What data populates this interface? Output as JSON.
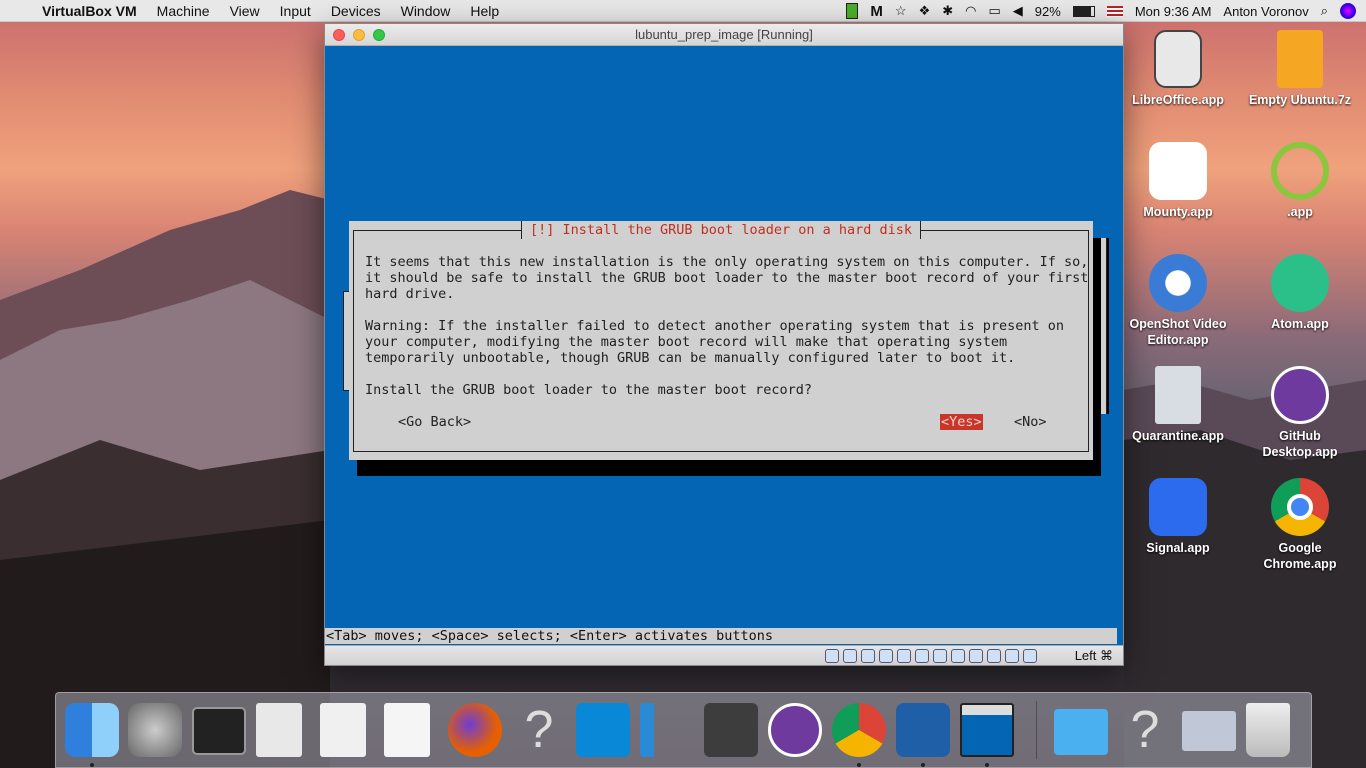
{
  "menubar": {
    "app_name": "VirtualBox VM",
    "menus": [
      "Machine",
      "View",
      "Input",
      "Devices",
      "Window",
      "Help"
    ],
    "battery": "92%",
    "clock": "Mon 9:36 AM",
    "user": "Anton Voronov",
    "status_icons": [
      "battery-icon",
      "malwarebytes-icon",
      "star-icon",
      "dropbox-icon",
      "bluetooth-icon",
      "wifi-icon",
      "airplay-icon",
      "volume-icon",
      "flag-us-icon",
      "search-icon",
      "siri-icon"
    ]
  },
  "vm": {
    "title": "lubuntu_prep_image [Running]",
    "dialog": {
      "title": "[!] Install the GRUB boot loader on a hard disk",
      "line1": "It seems that this new installation is the only operating system on this computer. If so,",
      "line2": "it should be safe to install the GRUB boot loader to the master boot record of your first",
      "line3": "hard drive.",
      "line4": "Warning: If the installer failed to detect another operating system that is present on",
      "line5": "your computer, modifying the master boot record will make that operating system",
      "line6": "temporarily unbootable, though GRUB can be manually configured later to boot it.",
      "question": "Install the GRUB boot loader to the master boot record?",
      "go_back": "<Go Back>",
      "yes": "<Yes>",
      "no": "<No>"
    },
    "help_line": "<Tab> moves; <Space> selects; <Enter> activates buttons",
    "host_key": "Left ⌘"
  },
  "desktop_icons": [
    {
      "label1": "LibreOffice.app",
      "label2": "",
      "color": "#e8e8e8"
    },
    {
      "label1": "Empty Ubuntu.7z",
      "label2": "",
      "color": "#f5a623"
    },
    {
      "label1": "Mounty.app",
      "label2": "",
      "color": "#ffffff"
    },
    {
      "label1": ".app",
      "label2": "",
      "color": "#8cc63f"
    },
    {
      "label1": "OpenShot Video",
      "label2": "Editor.app",
      "color": "#3a7bd5"
    },
    {
      "label1": "Atom.app",
      "label2": "",
      "color": "#2bbf8a"
    },
    {
      "label1": "Quarantine.app",
      "label2": "",
      "color": "#d8dde4"
    },
    {
      "label1": "GitHub",
      "label2": "Desktop.app",
      "color": "#6e3a9e"
    },
    {
      "label1": "Signal.app",
      "label2": "",
      "color": "#2c6bed"
    },
    {
      "label1": "Google",
      "label2": "Chrome.app",
      "color": "#db4437"
    }
  ],
  "dock": [
    {
      "name": "finder-icon",
      "color": "#3a8ee6"
    },
    {
      "name": "system-preferences-icon",
      "color": "#8a8a8a"
    },
    {
      "name": "terminal-icon",
      "color": "#222222"
    },
    {
      "name": "script-editor-icon",
      "color": "#e8e8e8"
    },
    {
      "name": "textedit-icon",
      "color": "#f0f0f0"
    },
    {
      "name": "notes-icon",
      "color": "#f5f5f5"
    },
    {
      "name": "firefox-icon",
      "color": "#e66000"
    },
    {
      "name": "unknown-app-icon",
      "color": "transparent"
    },
    {
      "name": "vnc-viewer-icon",
      "color": "#0a88d8"
    },
    {
      "name": "vscode-icon",
      "color": "#2a8ad6"
    },
    {
      "name": "sublime-text-icon",
      "color": "#3d3d3d"
    },
    {
      "name": "github-desktop-icon",
      "color": "#6e3a9e"
    },
    {
      "name": "chrome-icon",
      "color": "#db4437"
    },
    {
      "name": "virtualbox-icon",
      "color": "#1f5fa8"
    },
    {
      "name": "vm-window-icon",
      "color": "#2a3a5a"
    },
    {
      "name": "downloads-folder-icon",
      "color": "#4ab0f0"
    },
    {
      "name": "unknown-app-icon-2",
      "color": "transparent"
    },
    {
      "name": "virtualbox-vm-icon",
      "color": "#c0c8d8"
    },
    {
      "name": "trash-icon",
      "color": "#d8d8d8"
    }
  ]
}
